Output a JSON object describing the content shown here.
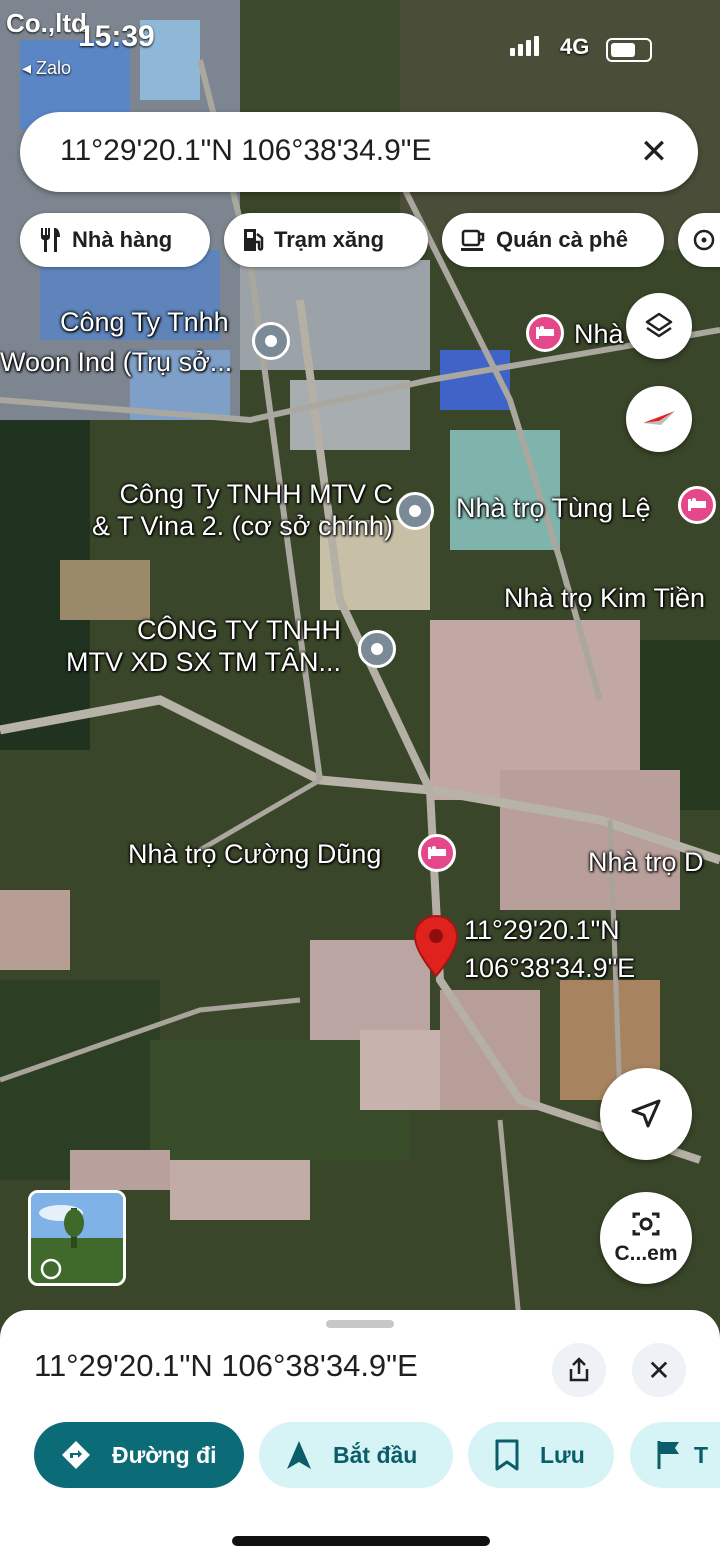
{
  "status_bar": {
    "carrier": "Co.,ltd",
    "time": "15:39",
    "back_app": "◂ Zalo",
    "network": "4G"
  },
  "search": {
    "query": "11°29'20.1\"N 106°38'34.9\"E"
  },
  "chips": [
    "Nhà hàng",
    "Trạm xăng",
    "Quán cà phê"
  ],
  "map_labels": {
    "poi1_line1": "Công Ty Tnhh",
    "poi1_line2": "Woon Ind (Trụ sở...",
    "poi2_line1": "Công Ty TNHH MTV C",
    "poi2_line2": "& T Vina 2. (cơ sở chính)",
    "poi3_line1": "CÔNG TY TNHH",
    "poi3_line2": "MTV XD SX TM TÂN...",
    "lodging1": "Nhà trọ Tùng Lệ",
    "lodging2": "Nhà trọ Kim Tiền",
    "lodging3": "Nhà trọ Cường Dũng",
    "lodging4": "Nhà trọ D",
    "lodging5": "Nhà",
    "pin_line1": "11°29'20.1\"N",
    "pin_line2": "106°38'34.9\"E"
  },
  "lens_button_label": "C...em",
  "sheet": {
    "title": "11°29'20.1\"N 106°38'34.9\"E",
    "actions": [
      "Đường đi",
      "Bắt đầu",
      "Lưu",
      "T"
    ]
  },
  "colors": {
    "primary": "#0b6b77",
    "secondary_bg": "#d6f3f6",
    "pin": "#e0221f",
    "lodging": "#e4478a"
  }
}
